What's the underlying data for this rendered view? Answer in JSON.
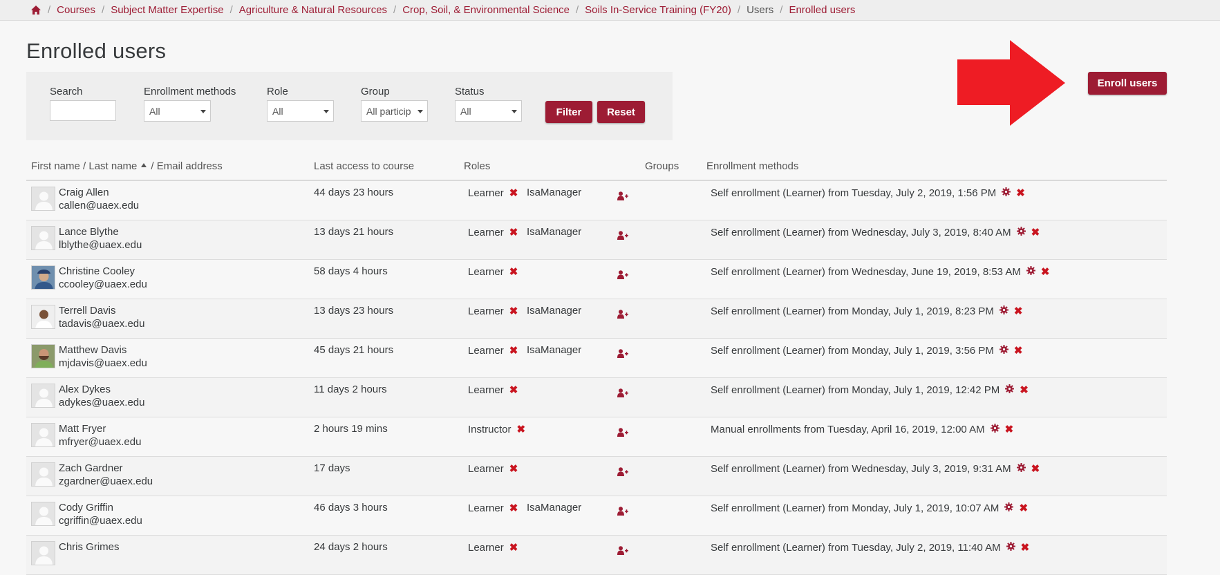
{
  "breadcrumb": [
    "Courses",
    "Subject Matter Expertise",
    "Agriculture & Natural Resources",
    "Crop, Soil, & Environmental Science",
    "Soils In-Service Training (FY20)",
    "Users",
    "Enrolled users"
  ],
  "page_title": "Enrolled users",
  "filters": {
    "search_label": "Search",
    "search_value": "",
    "enrollment_methods_label": "Enrollment methods",
    "enrollment_methods_value": "All",
    "role_label": "Role",
    "role_value": "All",
    "group_label": "Group",
    "group_value": "All particip",
    "status_label": "Status",
    "status_value": "All",
    "filter_button": "Filter",
    "reset_button": "Reset"
  },
  "enroll_users_button": "Enroll users",
  "table": {
    "col_name": "First name / Last name",
    "col_email": "/ Email address",
    "col_access": "Last access to course",
    "col_roles": "Roles",
    "col_groups": "Groups",
    "col_enrollment": "Enrollment methods"
  },
  "users": [
    {
      "name": "Craig Allen",
      "email": "callen@uaex.edu",
      "access": "44 days 23 hours",
      "role1": "Learner",
      "role2": "IsaManager",
      "enrollment": "Self enrollment (Learner) from Tuesday, July 2, 2019, 1:56 PM",
      "avatar": "default"
    },
    {
      "name": "Lance Blythe",
      "email": "lblythe@uaex.edu",
      "access": "13 days 21 hours",
      "role1": "Learner",
      "role2": "IsaManager",
      "enrollment": "Self enrollment (Learner) from Wednesday, July 3, 2019, 8:40 AM",
      "avatar": "default"
    },
    {
      "name": "Christine Cooley",
      "email": "ccooley@uaex.edu",
      "access": "58 days 4 hours",
      "role1": "Learner",
      "role2": "",
      "enrollment": "Self enrollment (Learner) from Wednesday, June 19, 2019, 8:53 AM",
      "avatar": "photo-blue"
    },
    {
      "name": "Terrell Davis",
      "email": "tadavis@uaex.edu",
      "access": "13 days 23 hours",
      "role1": "Learner",
      "role2": "IsaManager",
      "enrollment": "Self enrollment (Learner) from Monday, July 1, 2019, 8:23 PM",
      "avatar": "photo-white"
    },
    {
      "name": "Matthew Davis",
      "email": "mjdavis@uaex.edu",
      "access": "45 days 21 hours",
      "role1": "Learner",
      "role2": "IsaManager",
      "enrollment": "Self enrollment (Learner) from Monday, July 1, 2019, 3:56 PM",
      "avatar": "photo-green"
    },
    {
      "name": "Alex Dykes",
      "email": "adykes@uaex.edu",
      "access": "11 days 2 hours",
      "role1": "Learner",
      "role2": "",
      "enrollment": "Self enrollment (Learner) from Monday, July 1, 2019, 12:42 PM",
      "avatar": "default"
    },
    {
      "name": "Matt Fryer",
      "email": "mfryer@uaex.edu",
      "access": "2 hours 19 mins",
      "role1": "Instructor",
      "role2": "",
      "enrollment": "Manual enrollments from Tuesday, April 16, 2019, 12:00 AM",
      "avatar": "default"
    },
    {
      "name": "Zach Gardner",
      "email": "zgardner@uaex.edu",
      "access": "17 days",
      "role1": "Learner",
      "role2": "",
      "enrollment": "Self enrollment (Learner) from Wednesday, July 3, 2019, 9:31 AM",
      "avatar": "default"
    },
    {
      "name": "Cody Griffin",
      "email": "cgriffin@uaex.edu",
      "access": "46 days 3 hours",
      "role1": "Learner",
      "role2": "IsaManager",
      "enrollment": "Self enrollment (Learner) from Monday, July 1, 2019, 10:07 AM",
      "avatar": "default"
    },
    {
      "name": "Chris Grimes",
      "email": "",
      "access": "24 days 2 hours",
      "role1": "Learner",
      "role2": "",
      "enrollment": "Self enrollment (Learner) from Tuesday, July 2, 2019, 11:40 AM",
      "avatar": "default"
    }
  ],
  "colors": {
    "brand": "#9d1c34",
    "delete": "#c9141f",
    "arrow": "#ee1c24"
  }
}
